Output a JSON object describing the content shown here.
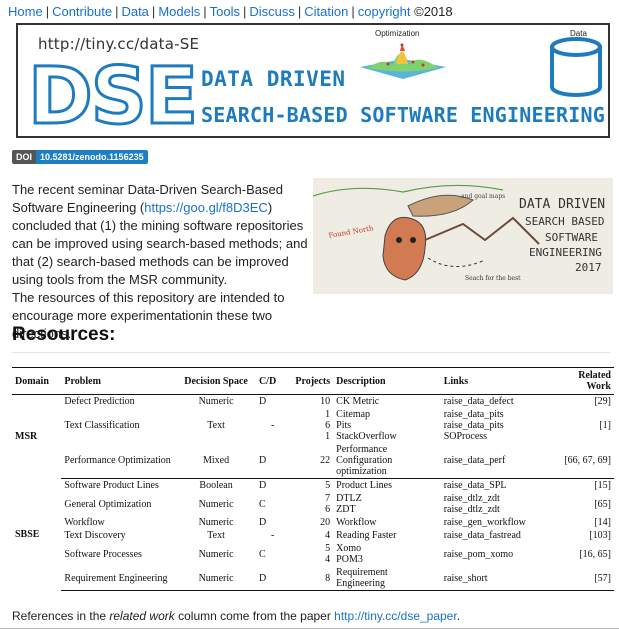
{
  "nav": {
    "links": [
      "Home",
      "Contribute",
      "Data",
      "Models",
      "Tools",
      "Discuss",
      "Citation",
      "copyright"
    ],
    "suffix": "©2018"
  },
  "banner": {
    "url": "http://tiny.cc/data-SE",
    "logo": "DSE",
    "tagline1": "DATA DRIVEN",
    "tagline2": "SEARCH-BASED SOFTWARE ENGINEERING",
    "opt_label": "Optimization",
    "data_label": "Data"
  },
  "doi": {
    "label": "DOI",
    "value": "10.5281/zenodo.1156235"
  },
  "intro": {
    "p1_before": "The recent seminar Data-Driven Search-Based Software Engineering (",
    "p1_link": "https://goo.gl/f8D3EC",
    "p1_after": ") concluded that (1) the mining software repositories can be improved using search-based methods; and that (2) search-based methods can be improved using tools from the MSR community.",
    "p2": "The resources of this repository are intended to encourage more experimentationin these two directions."
  },
  "sketch": {
    "lines": [
      "DATA DRIVEN",
      "SEARCH BASED",
      "SOFTWARE",
      "ENGINEERING",
      "2017"
    ]
  },
  "resources_title": "Resources:",
  "table": {
    "headers": [
      "Domain",
      "Problem",
      "Decision Space",
      "C/D",
      "Projects",
      "Description",
      "Links",
      "Related Work"
    ],
    "rows": [
      {
        "domain": "MSR",
        "problem": "Defect Prediction",
        "space": "Numeric",
        "cd": "D",
        "projects": [
          "10"
        ],
        "desc": [
          "CK Metric"
        ],
        "links": [
          "raise_data_defect"
        ],
        "related": "[29]"
      },
      {
        "domain": "",
        "problem": "Text Classification",
        "space": "Text",
        "cd": "-",
        "projects": [
          "1",
          "6",
          "1"
        ],
        "desc": [
          "Citemap",
          "Pits",
          "StackOverflow"
        ],
        "links": [
          "raise_data_pits",
          "raise_data_pits",
          "SOProcess"
        ],
        "related": "[1]"
      },
      {
        "domain": "",
        "problem": "Performance Optimization",
        "space": "Mixed",
        "cd": "D",
        "projects": [
          "22"
        ],
        "desc": [
          "Performance Configuration optimization"
        ],
        "links": [
          "raise_data_perf"
        ],
        "related": "[66, 67, 69]"
      },
      {
        "domain": "SBSE",
        "problem": "Software Product Lines",
        "space": "Boolean",
        "cd": "D",
        "projects": [
          "5"
        ],
        "desc": [
          "Product Lines"
        ],
        "links": [
          "raise_data_SPL"
        ],
        "related": "[15]"
      },
      {
        "domain": "",
        "problem": "General Optimization",
        "space": "Numeric",
        "cd": "C",
        "projects": [
          "7",
          "6"
        ],
        "desc": [
          "DTLZ",
          "ZDT"
        ],
        "links": [
          "raise_dtlz_zdt",
          "raise_dtlz_zdt"
        ],
        "related": "[65]"
      },
      {
        "domain": "",
        "problem": "Workflow",
        "space": "Numeric",
        "cd": "D",
        "projects": [
          "20"
        ],
        "desc": [
          "Workflow"
        ],
        "links": [
          "raise_gen_workflow"
        ],
        "related": "[14]"
      },
      {
        "domain": "",
        "problem": "Text Discovery",
        "space": "Text",
        "cd": "-",
        "projects": [
          "4"
        ],
        "desc": [
          "Reading Faster"
        ],
        "links": [
          "raise_data_fastread"
        ],
        "related": "[103]"
      },
      {
        "domain": "",
        "problem": "Software Processes",
        "space": "Numeric",
        "cd": "C",
        "projects": [
          "5",
          "4"
        ],
        "desc": [
          "Xomo",
          "POM3"
        ],
        "links": [
          "raise_pom_xomo"
        ],
        "related": "[16, 65]"
      },
      {
        "domain": "",
        "problem": "Requirement Engineering",
        "space": "Numeric",
        "cd": "D",
        "projects": [
          "8"
        ],
        "desc": [
          "Requirement Engineering"
        ],
        "links": [
          "raise_short"
        ],
        "related": "[57]"
      }
    ]
  },
  "footer": {
    "before": "References in the ",
    "em": "related work",
    "after": " column come from the paper ",
    "link": "http://tiny.cc/dse_paper",
    "end": "."
  }
}
